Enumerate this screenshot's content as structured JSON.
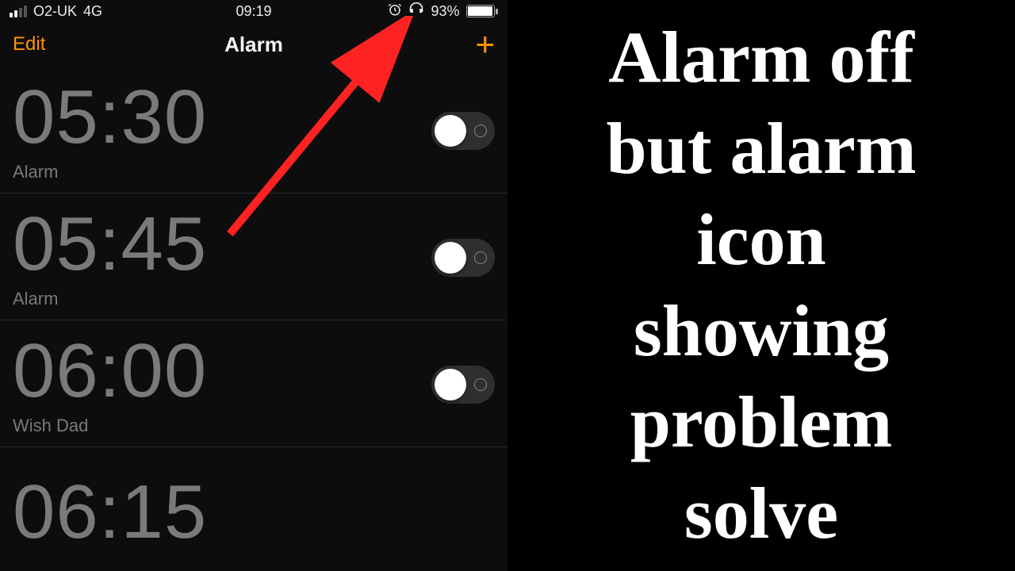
{
  "status_bar": {
    "carrier": "O2-UK",
    "network": "4G",
    "time": "09:19",
    "battery_pct": "93%",
    "battery_fill_pct": 93
  },
  "nav": {
    "edit": "Edit",
    "title": "Alarm",
    "add": "+"
  },
  "alarms": [
    {
      "time": "05:30",
      "label": "Alarm"
    },
    {
      "time": "05:45",
      "label": "Alarm"
    },
    {
      "time": "06:00",
      "label": "Wish Dad"
    },
    {
      "time": "06:15",
      "label": ""
    }
  ],
  "caption": {
    "l1": "Alarm off",
    "l2": "but alarm",
    "l3": "icon",
    "l4": "showing",
    "l5": "problem",
    "l6": "solve"
  }
}
